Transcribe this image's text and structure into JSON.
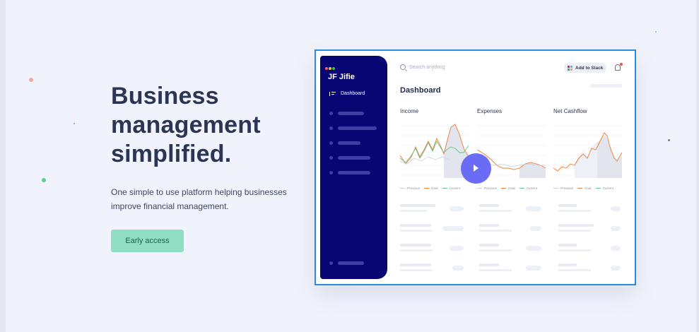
{
  "hero": {
    "title": "Business management simplified.",
    "subtitle": "One simple to use platform helping businesses improve financial management.",
    "cta_label": "Early access"
  },
  "app": {
    "logo": "JF Jifie",
    "nav_active": "Dashboard",
    "search_placeholder": "Search anything",
    "slack_label": "Add to Slack",
    "page_title": "Dashboard",
    "columns": [
      {
        "title": "Income"
      },
      {
        "title": "Expenses"
      },
      {
        "title": "Net Cashflow"
      }
    ],
    "legend": [
      "Previous",
      "Goal",
      "Current"
    ]
  },
  "colors": {
    "accent": "#8fdec3",
    "sidebar": "#070672",
    "play": "#6a6cf6",
    "series_previous": "#c9cddc",
    "series_goal": "#f07a2a",
    "series_current": "#5fc38e"
  },
  "icons": [
    "search-icon",
    "slack-icon",
    "bell-icon",
    "play-icon",
    "dashboard-icon"
  ]
}
